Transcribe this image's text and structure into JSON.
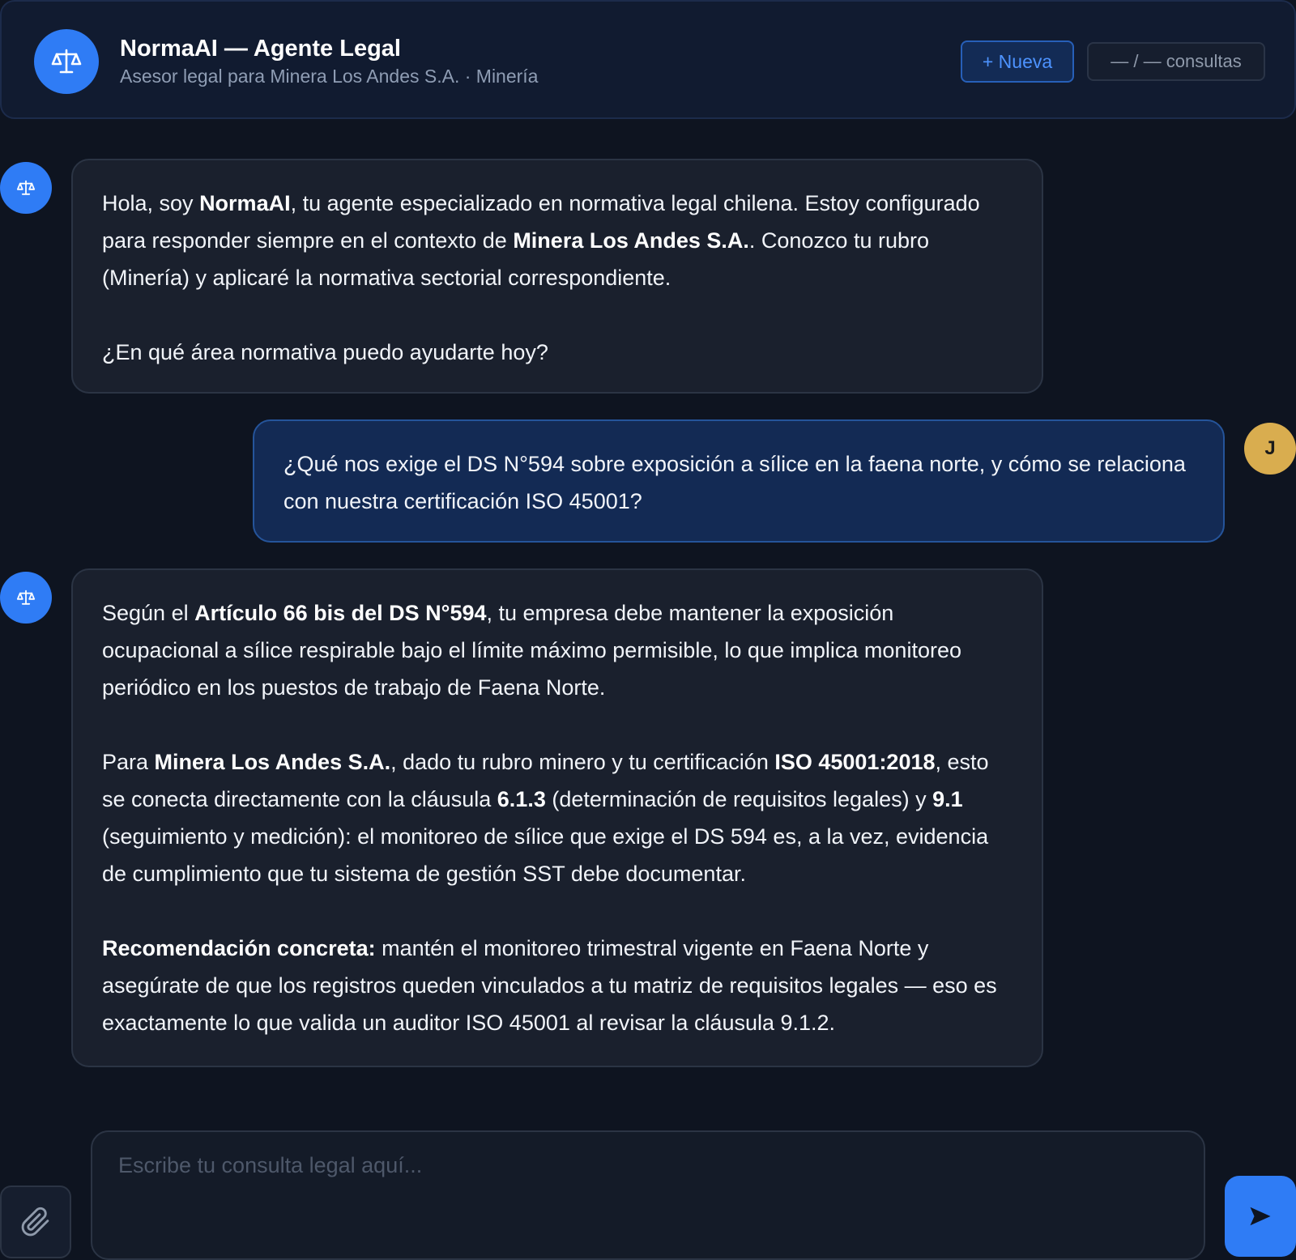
{
  "header": {
    "title": "NormaAI — Agente Legal",
    "subtitle": "Asesor legal para Minera Los Andes S.A. · Minería",
    "brand_icon": "scales-icon",
    "new_button": "+ Nueva",
    "count_button": "— / — consultas"
  },
  "colors": {
    "background": "#0e1420",
    "accent": "#2f7cf5",
    "user_avatar": "#d9ad4f",
    "bot_bubble": "#1a202d",
    "user_bubble": "#132a54"
  },
  "messages": {
    "m1": {
      "p1_a": "Hola, soy ",
      "p1_b": "NormaAI",
      "p1_c": ", tu agente especializado en normativa legal chilena. Estoy configurado para responder siempre en el contexto de ",
      "p1_d": "Minera Los Andes S.A.",
      "p1_e": ". Conozco tu rubro (Minería) y aplicaré la normativa sectorial correspondiente.",
      "p2": "¿En qué área normativa puedo ayudarte hoy?"
    },
    "m2": {
      "avatar": "J",
      "text": "¿Qué nos exige el DS N°594 sobre exposición a sílice en la faena norte, y cómo se relaciona con nuestra certificación ISO 45001?"
    },
    "m3": {
      "p1_a": "Según el ",
      "p1_b": "Artículo 66 bis del DS N°594",
      "p1_c": ", tu empresa debe mantener la exposición ocupacional a sílice respirable bajo el límite máximo permisible, lo que implica monitoreo periódico en los puestos de trabajo de Faena Norte.",
      "p2_a": "Para ",
      "p2_b": "Minera Los Andes S.A.",
      "p2_c": ", dado tu rubro minero y tu certificación ",
      "p2_d": "ISO 45001:2018",
      "p2_e": ", esto se conecta directamente con la cláusula ",
      "p2_f": "6.1.3",
      "p2_g": " (determinación de requisitos legales) y ",
      "p2_h": "9.1",
      "p2_i": " (seguimiento y medición): el monitoreo de sílice que exige el DS 594 es, a la vez, evidencia de cumplimiento que tu sistema de gestión SST debe documentar.",
      "p3_a": "Recomendación concreta:",
      "p3_b": " mantén el monitoreo trimestral vigente en Faena Norte y asegúrate de que los registros queden vinculados a tu matriz de requisitos legales — eso es exactamente lo que valida un auditor ISO 45001 al revisar la cláusula 9.1.2."
    }
  },
  "composer": {
    "placeholder": "Escribe tu consulta legal aquí...",
    "attach_icon": "paperclip-icon",
    "send_icon": "send-icon"
  }
}
